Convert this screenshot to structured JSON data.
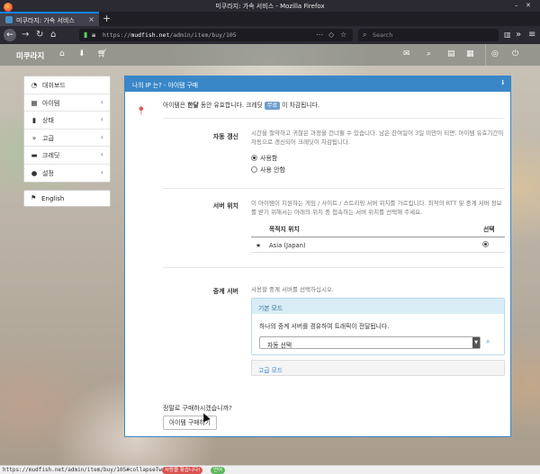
{
  "browser": {
    "window_title": "미쿠라지: 가속 서비스 - Mozilla Firefox",
    "tab_title": "미쿠라지: 가속 서비스",
    "url_prefix": "https://",
    "url_host": "mudfish.net",
    "url_path": "/admin/item/buy/105",
    "search_placeholder": "Search",
    "new_tab_glyph": "+",
    "close_glyph": "×"
  },
  "app": {
    "brand": "미쿠라지",
    "nav_icons": [
      "home-icon",
      "download-icon",
      "cart-icon",
      "chat-icon",
      "search-icon",
      "book-icon",
      "grid-icon",
      "settings-icon",
      "logout-icon"
    ]
  },
  "sidebar": {
    "items": [
      {
        "icon": "dashboard-icon",
        "label": "대쉬보드",
        "has_chevron": false
      },
      {
        "icon": "items-icon",
        "label": "아이템",
        "has_chevron": true
      },
      {
        "icon": "status-icon",
        "label": "상태",
        "has_chevron": true
      },
      {
        "icon": "advanced-icon",
        "label": "고급",
        "has_chevron": true
      },
      {
        "icon": "credit-icon",
        "label": "크레딧",
        "has_chevron": true
      },
      {
        "icon": "settings-icon",
        "label": "설정",
        "has_chevron": true
      }
    ],
    "chevron": "‹",
    "language": "English"
  },
  "panel": {
    "title_prefix": "나의 IP 는? - ",
    "title_suffix": "아이템 구매",
    "intro_a": "아이템은 ",
    "intro_bold": "한달",
    "intro_b": " 동안 유효합니다. 크레딧 ",
    "intro_badge": "무료",
    "intro_c": " 이 차감됩니다.",
    "renew": {
      "label": "자동 갱신",
      "help": "시간을 절약하고 귀찮은 과정을 건너뛸 수 있습니다. 남은 잔여일이 3일 미만이 되면, 아이템 유효기간이 자동으로 갱신되어 크레딧이 차감됩니다.",
      "options": [
        {
          "label": "사용함",
          "selected": true
        },
        {
          "label": "사용 안함",
          "selected": false
        }
      ]
    },
    "server": {
      "label": "서버 위치",
      "help": "이 아이템이 지원하는 게임 / 사이트 / 스트리밍 서버 위치를 가르킵니다. 최적의 RTT 및 중계 서버 정보를 받기 위해서는 아래의 위치 중 접속하는 서버 위치를 선택해 주세요.",
      "col_location": "목적지 위치",
      "col_select": "선택",
      "rows": [
        {
          "location": "Asia (Japan)",
          "selected": true
        }
      ]
    },
    "relay": {
      "label": "중계 서버",
      "help": "사용할 중계 서버를 선택하십시오.",
      "basic_title": "기본 모드",
      "basic_text": "하나의 중계 서버를 경유하여 트래픽이 전달됩니다.",
      "select_value": "자동 선택",
      "advanced_title": "고급 모드"
    },
    "confirm_text": "정말로 구매하시겠습니까?",
    "buy_button": "아이템 구매하기"
  },
  "statusbar": {
    "url": "https://mudfish.net/admin/item/buy/105#collapseTwo",
    "pill_red": "사랑을 찾습니다!",
    "pill_green": "언어"
  },
  "colors": {
    "accent": "#3a87c8",
    "pin": "#d9534f",
    "pill_red": "#d9534f",
    "pill_green": "#5cb85c"
  }
}
